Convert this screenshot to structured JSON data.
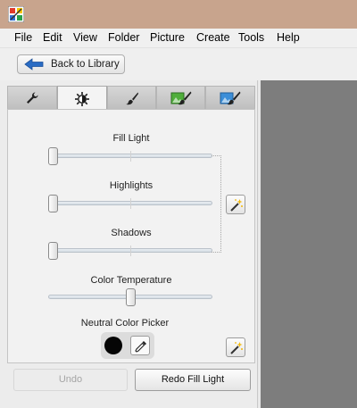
{
  "menu": {
    "items": [
      "File",
      "Edit",
      "View",
      "Folder",
      "Picture",
      "Create",
      "Tools",
      "Help"
    ]
  },
  "toolbar": {
    "back_label": "Back to Library"
  },
  "tabs": [
    {
      "icon": "wrench-icon",
      "active": false
    },
    {
      "icon": "sun-tuning-icon",
      "active": true
    },
    {
      "icon": "brush-icon",
      "active": false
    },
    {
      "icon": "green-image-brush-icon",
      "active": false
    },
    {
      "icon": "blue-image-brush-icon",
      "active": false
    }
  ],
  "tuning": {
    "fill_light": {
      "label": "Fill Light",
      "value": 0
    },
    "highlights": {
      "label": "Highlights",
      "value": 0
    },
    "shadows": {
      "label": "Shadows",
      "value": 0
    },
    "color_temperature": {
      "label": "Color Temperature",
      "value": 0.5
    },
    "neutral_picker_label": "Neutral Color Picker"
  },
  "actions": {
    "undo_label": "Undo",
    "undo_enabled": false,
    "redo_label": "Redo Fill Light"
  },
  "colors": {
    "title_bar": "#c8a48d",
    "canvas": "#7d7d7d",
    "back_arrow": "#2a6cc4"
  }
}
